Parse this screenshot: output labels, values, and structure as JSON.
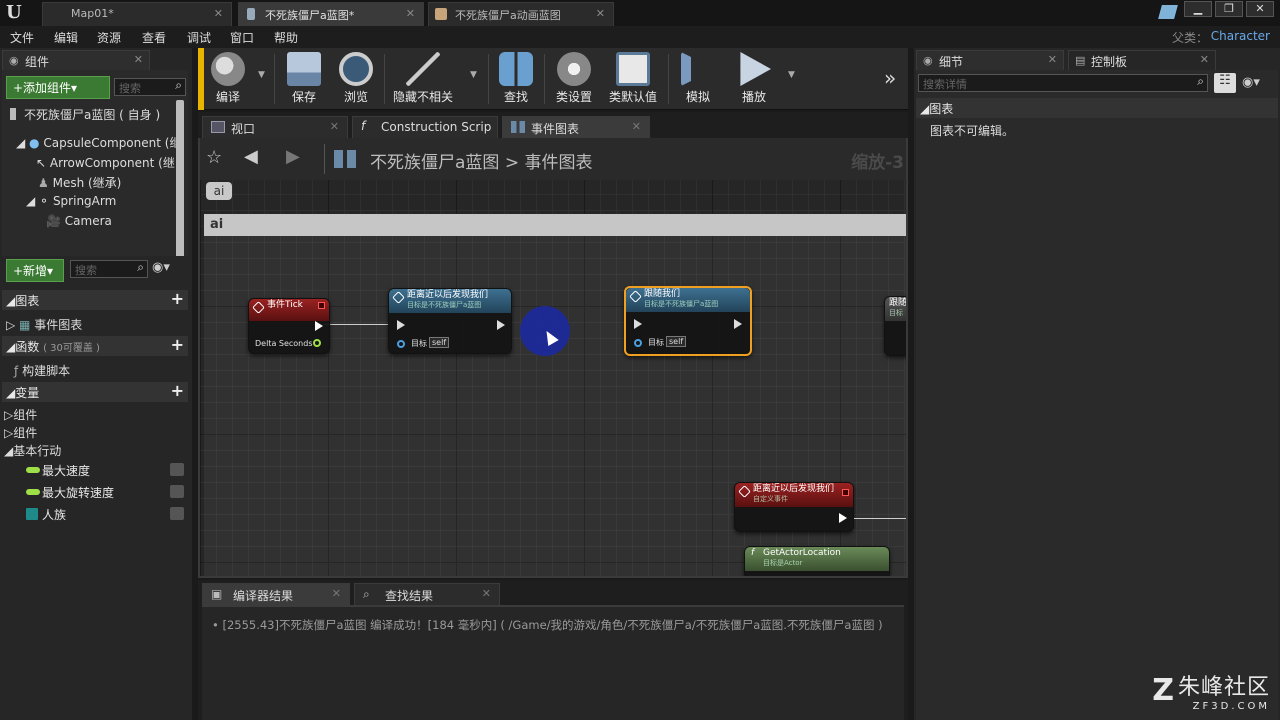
{
  "titlebar": {
    "tabs": [
      {
        "label": "Map01*"
      },
      {
        "label": "不死族僵尸a蓝图*"
      },
      {
        "label": "不死族僵尸a动画蓝图"
      }
    ]
  },
  "menu": {
    "items": [
      "文件",
      "编辑",
      "资源",
      "查看",
      "调试",
      "窗口",
      "帮助"
    ],
    "parent_label": "父类：",
    "parent_value": "Character"
  },
  "components_panel": {
    "tab_label": "组件",
    "add_button": "+添加组件▾",
    "search_placeholder": "搜索",
    "root": "不死族僵尸a蓝图 ( 自身 )",
    "tree": [
      "CapsuleComponent (继",
      "ArrowComponent (继",
      "Mesh (继承)",
      "SpringArm",
      "Camera"
    ]
  },
  "my_blueprint": {
    "new_button": "+新增▾",
    "search_placeholder": "搜索",
    "graphs_header": "图表",
    "event_graph": "事件图表",
    "functions_header": "函数",
    "functions_note": "( 30可覆盖 )",
    "construction_script": "构建脚本",
    "variables_header": "变量",
    "var_groups": [
      "组件",
      "组件",
      "基本行动"
    ],
    "variables": [
      {
        "label": "最大速度",
        "color": "#9fe048"
      },
      {
        "label": "最大旋转速度",
        "color": "#9fe048"
      },
      {
        "label": "人族",
        "color": "#1f8a8a"
      }
    ]
  },
  "toolbar": {
    "buttons": [
      "编译",
      "保存",
      "浏览",
      "隐藏不相关",
      "查找",
      "类设置",
      "类默认值",
      "模拟",
      "播放"
    ]
  },
  "editor_tabs": [
    "视口",
    "Construction Scrip",
    "事件图表"
  ],
  "graph": {
    "breadcrumb_root": "不死族僵尸a蓝图",
    "breadcrumb_sep": ">",
    "breadcrumb_leaf": "事件图表",
    "zoom_label": "缩放-3",
    "comment_bubble": "ai",
    "comment_title": "ai",
    "nodes": {
      "tick": {
        "title": "事件Tick",
        "pin": "Delta Seconds"
      },
      "near1": {
        "title": "距离近以后发现我们",
        "subtitle": "目标是不死族僵尸a蓝图",
        "target_label": "目标",
        "self_label": "self"
      },
      "follow": {
        "title": "跟随我们",
        "subtitle": "目标是不死族僵尸a蓝图",
        "target_label": "目标",
        "self_label": "self"
      },
      "partial": {
        "title": "跟随",
        "subtitle": "目标"
      },
      "custom": {
        "title": "距离近以后发现我们",
        "subtitle": "自定义事件"
      },
      "getloc": {
        "title": "GetActorLocation",
        "subtitle": "目标是Actor"
      }
    }
  },
  "bottom_panel": {
    "tabs": [
      "编译器结果",
      "查找结果"
    ],
    "log": "[2555.43]不死族僵尸a蓝图 编译成功！[184 毫秒内] ( /Game/我的游戏/角色/不死族僵尸a/不死族僵尸a蓝图.不死族僵尸a蓝图 )"
  },
  "details_panel": {
    "tabs": [
      "细节",
      "控制板"
    ],
    "search_placeholder": "搜索详情",
    "section": "图表",
    "message": "图表不可编辑。"
  },
  "watermark": {
    "brand": "朱峰社区",
    "url": "ZF3D.COM"
  },
  "colors": {
    "event_red": "#8a1c1c",
    "function_blue": "#2e5a74",
    "selected_orange": "#f0a020",
    "parent_link": "#6aa8e8"
  }
}
